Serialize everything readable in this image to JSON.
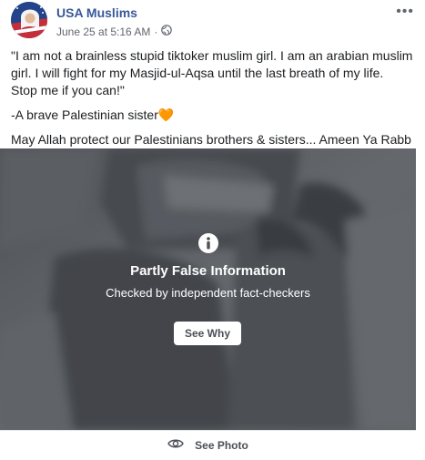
{
  "post": {
    "page_name": "USA Muslims",
    "timestamp": "June 25 at 5:16 AM",
    "separator": "·",
    "menu_glyph": "•••",
    "text": {
      "line1": "\"I am not a brainless stupid tiktoker muslim girl. I am an arabian muslim girl. I will fight for my Masjid-ul-Aqsa until the last breath of my life.",
      "line2": "Stop me if you can!\"",
      "line3": "-A brave Palestinian sister",
      "line3_emoji": "🧡",
      "line4": "May Allah protect our Palestinians brothers & sisters... Ameen Ya Rabb",
      "line4_emoji": "🤲"
    }
  },
  "fact_check": {
    "title": "Partly False Information",
    "subtitle": "Checked by independent fact-checkers",
    "button_label": "See Why"
  },
  "footer": {
    "label": "See Photo"
  },
  "icons": {
    "globe": "globe-icon",
    "info": "info-icon",
    "eye": "eye-icon"
  },
  "colors": {
    "page_name": "#385898",
    "meta": "#606770",
    "overlay": "#46494e",
    "button_text": "#4b4f56"
  }
}
